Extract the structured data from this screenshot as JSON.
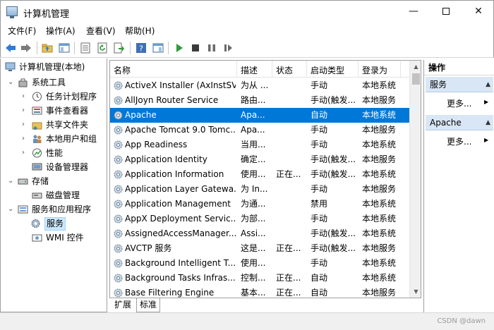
{
  "window": {
    "title": "计算机管理",
    "min_glyph": "—",
    "close_glyph": "✕"
  },
  "menu": {
    "items": [
      "文件(F)",
      "操作(A)",
      "查看(V)",
      "帮助(H)"
    ]
  },
  "tree": {
    "nodes": [
      {
        "label": "计算机管理(本地)",
        "icon": "computer-icon",
        "twisty": ""
      },
      {
        "label": "系统工具",
        "icon": "tools-icon",
        "twisty": "⌄"
      },
      {
        "label": "任务计划程序",
        "icon": "clock-icon",
        "twisty": "›"
      },
      {
        "label": "事件查看器",
        "icon": "event-viewer-icon",
        "twisty": "›"
      },
      {
        "label": "共享文件夹",
        "icon": "shared-folder-icon",
        "twisty": "›"
      },
      {
        "label": "本地用户和组",
        "icon": "users-icon",
        "twisty": "›"
      },
      {
        "label": "性能",
        "icon": "performance-icon",
        "twisty": "›"
      },
      {
        "label": "设备管理器",
        "icon": "device-manager-icon",
        "twisty": ""
      },
      {
        "label": "存储",
        "icon": "storage-icon",
        "twisty": "⌄"
      },
      {
        "label": "磁盘管理",
        "icon": "disk-icon",
        "twisty": ""
      },
      {
        "label": "服务和应用程序",
        "icon": "services-apps-icon",
        "twisty": "⌄"
      },
      {
        "label": "服务",
        "icon": "gear-icon",
        "twisty": ""
      },
      {
        "label": "WMI 控件",
        "icon": "wmi-icon",
        "twisty": ""
      }
    ]
  },
  "list": {
    "columns": [
      "名称",
      "描述",
      "状态",
      "启动类型",
      "登录为"
    ],
    "rows": [
      {
        "name": "ActiveX Installer (AxInstSV)",
        "desc": "为从 ...",
        "status": "",
        "startup": "手动",
        "logon": "本地系统"
      },
      {
        "name": "AllJoyn Router Service",
        "desc": "路由...",
        "status": "",
        "startup": "手动(触发...",
        "logon": "本地服务"
      },
      {
        "name": "Apache",
        "desc": "Apa...",
        "status": "",
        "startup": "自动",
        "logon": "本地系统"
      },
      {
        "name": "Apache Tomcat 9.0 Tomc...",
        "desc": "Apa...",
        "status": "",
        "startup": "手动",
        "logon": "本地服务"
      },
      {
        "name": "App Readiness",
        "desc": "当用...",
        "status": "",
        "startup": "手动",
        "logon": "本地系统"
      },
      {
        "name": "Application Identity",
        "desc": "确定...",
        "status": "",
        "startup": "手动(触发...",
        "logon": "本地服务"
      },
      {
        "name": "Application Information",
        "desc": "使用...",
        "status": "正在...",
        "startup": "手动(触发...",
        "logon": "本地系统"
      },
      {
        "name": "Application Layer Gatewa...",
        "desc": "为 In...",
        "status": "",
        "startup": "手动",
        "logon": "本地服务"
      },
      {
        "name": "Application Management",
        "desc": "为通...",
        "status": "",
        "startup": "禁用",
        "logon": "本地系统"
      },
      {
        "name": "AppX Deployment Servic...",
        "desc": "为部...",
        "status": "",
        "startup": "手动",
        "logon": "本地系统"
      },
      {
        "name": "AssignedAccessManager...",
        "desc": "Assi...",
        "status": "",
        "startup": "手动(触发...",
        "logon": "本地系统"
      },
      {
        "name": "AVCTP 服务",
        "desc": "这是...",
        "status": "正在...",
        "startup": "手动(触发...",
        "logon": "本地服务"
      },
      {
        "name": "Background Intelligent T...",
        "desc": "使用...",
        "status": "",
        "startup": "手动",
        "logon": "本地系统"
      },
      {
        "name": "Background Tasks Infras...",
        "desc": "控制...",
        "status": "正在...",
        "startup": "自动",
        "logon": "本地系统"
      },
      {
        "name": "Base Filtering Engine",
        "desc": "基本...",
        "status": "正在...",
        "startup": "自动",
        "logon": "本地服务"
      }
    ],
    "selected_index": 2
  },
  "tabs": [
    "扩展",
    "标准"
  ],
  "actions": {
    "title": "操作",
    "sections": [
      {
        "label": "服务",
        "more": "更多..."
      },
      {
        "label": "Apache",
        "more": "更多..."
      }
    ]
  },
  "watermark": "CSDN @dawn",
  "colors": {
    "selection": "#0078d7",
    "action_header": "#d9e6f5"
  }
}
